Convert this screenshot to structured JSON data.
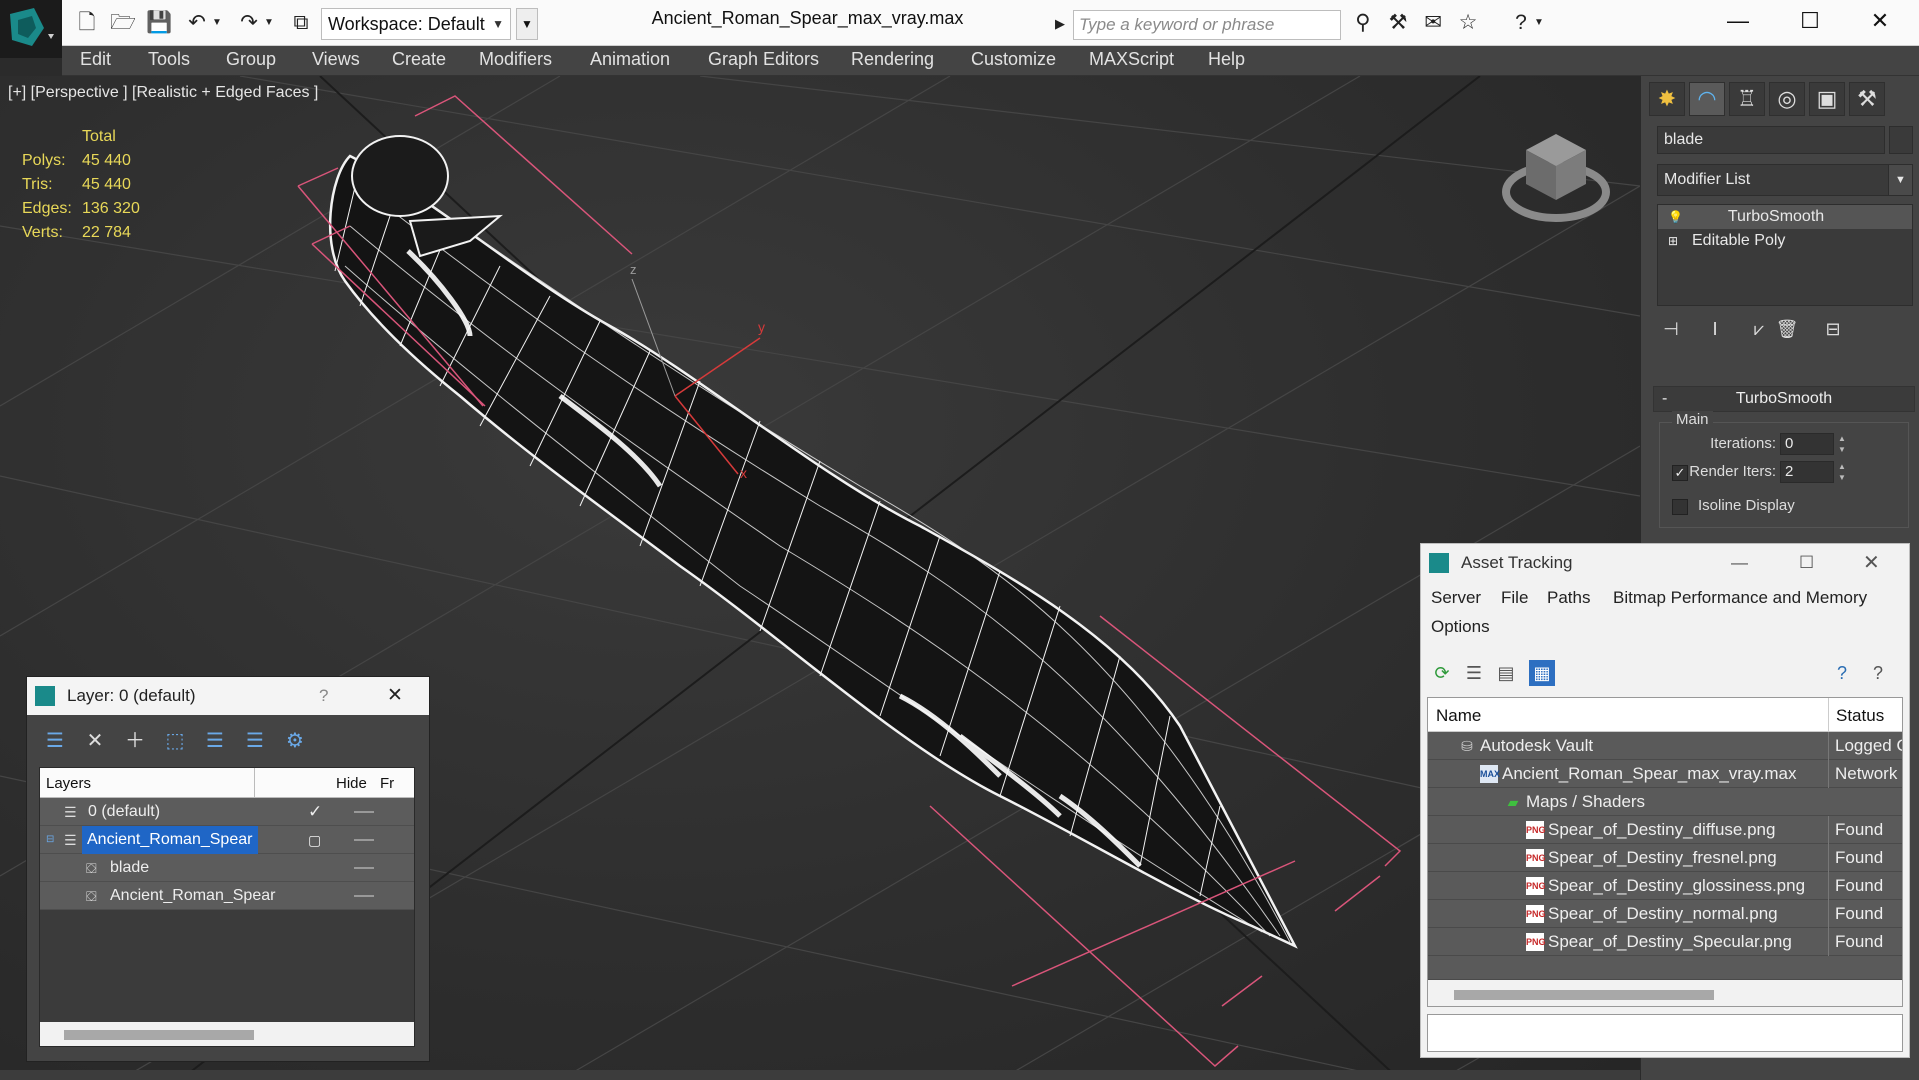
{
  "titlebar": {
    "window_title": "Ancient_Roman_Spear_max_vray.max",
    "workspace_label": "Workspace: Default",
    "search_placeholder": "Type a keyword or phrase",
    "minimize": "—",
    "maximize": "☐",
    "close": "✕"
  },
  "menu": [
    "Edit",
    "Tools",
    "Group",
    "Views",
    "Create",
    "Modifiers",
    "Animation",
    "Graph Editors",
    "Rendering",
    "Customize",
    "MAXScript",
    "Help"
  ],
  "viewport": {
    "label": "[+] [Perspective ] [Realistic + Edged Faces ]",
    "stats_header": "Total",
    "stats": [
      {
        "label": "Polys:",
        "value": "45 440"
      },
      {
        "label": "Tris:",
        "value": "45 440"
      },
      {
        "label": "Edges:",
        "value": "136 320"
      },
      {
        "label": "Verts:",
        "value": "22 784"
      }
    ],
    "axis_y": "y",
    "axis_x": "x",
    "axis_z": "z"
  },
  "command_panel": {
    "object_name": "blade",
    "modifier_list": "Modifier List",
    "stack": [
      {
        "label": "TurboSmooth",
        "selected": true
      },
      {
        "label": "Editable Poly",
        "selected": false
      }
    ],
    "rollout_title": "TurboSmooth",
    "group_main": "Main",
    "iterations_label": "Iterations:",
    "iterations_value": "0",
    "render_iters_label": "Render Iters:",
    "render_iters_value": "2",
    "render_iters_checked": "✓",
    "isoline_label": "Isoline Display"
  },
  "layer_panel": {
    "title": "Layer: 0 (default)",
    "help": "?",
    "close": "✕",
    "col_layers": "Layers",
    "col_hide": "Hide",
    "col_freeze": "Fr",
    "rows": [
      {
        "name": "0 (default)",
        "check": "✓"
      },
      {
        "name": "Ancient_Roman_Spear",
        "check": ""
      },
      {
        "name": "blade",
        "check": ""
      },
      {
        "name": "Ancient_Roman_Spear",
        "check": ""
      }
    ]
  },
  "asset_tracking": {
    "title": "Asset Tracking",
    "menu": [
      "Server",
      "File",
      "Paths",
      "Bitmap Performance and Memory",
      "Options"
    ],
    "col_name": "Name",
    "col_status": "Status",
    "rows": [
      {
        "name": "Autodesk Vault",
        "status": "Logged Out"
      },
      {
        "name": "Ancient_Roman_Spear_max_vray.max",
        "status": "Network"
      },
      {
        "name": "Maps / Shaders",
        "status": ""
      },
      {
        "name": "Spear_of_Destiny_diffuse.png",
        "status": "Found"
      },
      {
        "name": "Spear_of_Destiny_fresnel.png",
        "status": "Found"
      },
      {
        "name": "Spear_of_Destiny_glossiness.png",
        "status": "Found"
      },
      {
        "name": "Spear_of_Destiny_normal.png",
        "status": "Found"
      },
      {
        "name": "Spear_of_Destiny_Specular.png",
        "status": "Found"
      }
    ],
    "png_badge": "PNG",
    "max_badge": "MAX"
  },
  "colors": {
    "accent_blue": "#1f66c6",
    "stats_yellow": "#e8d858",
    "gizmo_pink": "#d9557a",
    "wire_white": "#f2f2f2"
  }
}
